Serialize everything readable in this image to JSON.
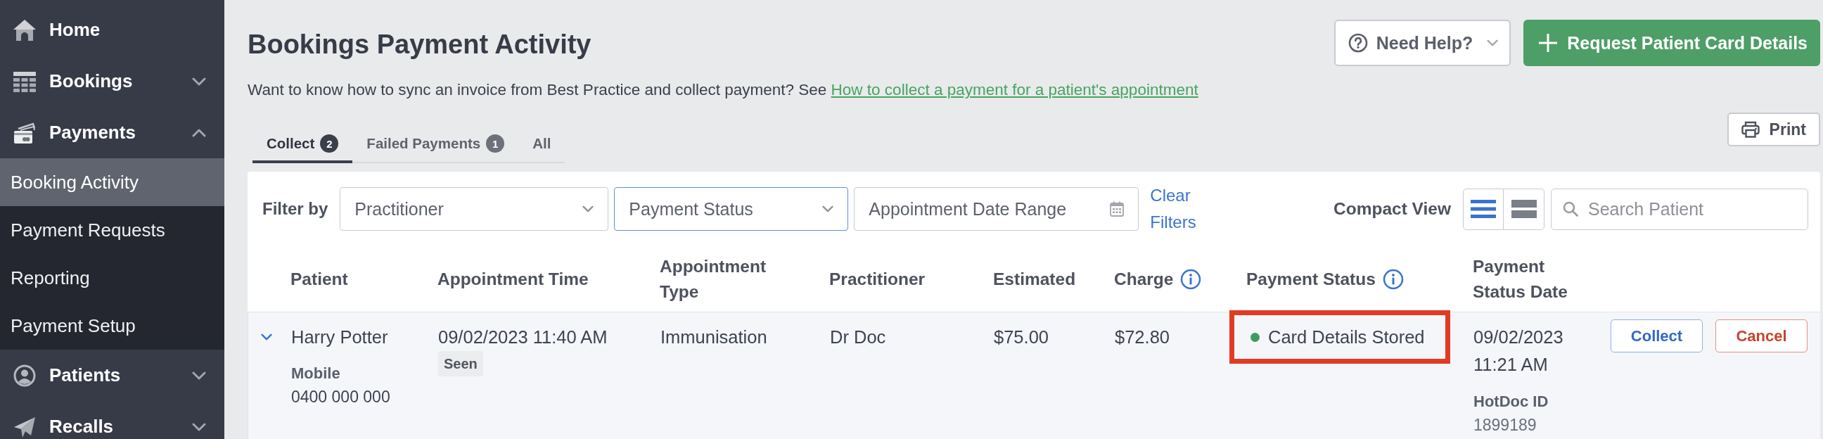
{
  "sidebar": {
    "items": [
      {
        "label": "Home"
      },
      {
        "label": "Bookings",
        "expanded": false
      },
      {
        "label": "Payments",
        "expanded": true,
        "children": [
          {
            "label": "Booking Activity",
            "selected": true
          },
          {
            "label": "Payment Requests",
            "selected": false
          },
          {
            "label": "Reporting",
            "selected": false
          },
          {
            "label": "Payment Setup",
            "selected": false
          }
        ]
      },
      {
        "label": "Patients",
        "expanded": false
      },
      {
        "label": "Recalls",
        "expanded": false
      }
    ]
  },
  "header": {
    "title": "Bookings Payment Activity",
    "help_button": "Need Help?",
    "primary_button": "Request Patient Card Details"
  },
  "intro": {
    "text": "Want to know how to sync an invoice from Best Practice and collect payment? See",
    "link": "How to collect a payment for a patient's appointment"
  },
  "tabs": [
    {
      "label": "Collect",
      "count": "2",
      "selected": true
    },
    {
      "label": "Failed Payments",
      "count": "1",
      "selected": false
    },
    {
      "label": "All",
      "selected": false
    }
  ],
  "print_button": "Print",
  "filters": {
    "label": "Filter by",
    "fields": [
      {
        "kind": "select",
        "placeholder": "Practitioner",
        "focused": false
      },
      {
        "kind": "select",
        "placeholder": "Payment Status",
        "focused": true
      },
      {
        "kind": "date",
        "placeholder": "Appointment Date Range",
        "focused": false
      }
    ],
    "clear_link": "Clear Filters"
  },
  "view": {
    "label": "Compact View",
    "options": [
      {
        "selected": true
      },
      {
        "selected": false
      }
    ]
  },
  "search": {
    "placeholder": "Search Patient"
  },
  "table": {
    "columns": [
      {
        "label": "Patient",
        "kind": "plain"
      },
      {
        "label": "Appointment Time",
        "kind": "plain"
      },
      {
        "label": "Appointment Type",
        "kind": "plain"
      },
      {
        "label": "Practitioner",
        "kind": "plain"
      },
      {
        "label": "Estimated",
        "kind": "plain"
      },
      {
        "label": "Charge",
        "kind": "info"
      },
      {
        "label": "Payment Status",
        "kind": "info"
      },
      {
        "label": "Payment Status Date",
        "kind": "plain"
      }
    ],
    "rows": [
      {
        "expanded": false,
        "patient": {
          "name": "Harry Potter",
          "phone_label": "Mobile",
          "phone": "0400 000 000"
        },
        "appointment_time": "09/02/2023 11:40 AM",
        "attendance": "Seen",
        "appointment_type": "Immunisation",
        "practitioner": "Dr Doc",
        "estimated": "$75.00",
        "charge": "$72.80",
        "payment_status": {
          "label": "Card Details Stored",
          "color": "#3f9c5e",
          "highlighted": true
        },
        "status_date": "09/02/2023 11:21 AM",
        "hotdoc_label": "HotDoc ID",
        "hotdoc_id": "1899189",
        "actions": [
          {
            "label": "Collect",
            "kind": "primary"
          },
          {
            "label": "Cancel",
            "kind": "danger"
          }
        ]
      }
    ]
  }
}
